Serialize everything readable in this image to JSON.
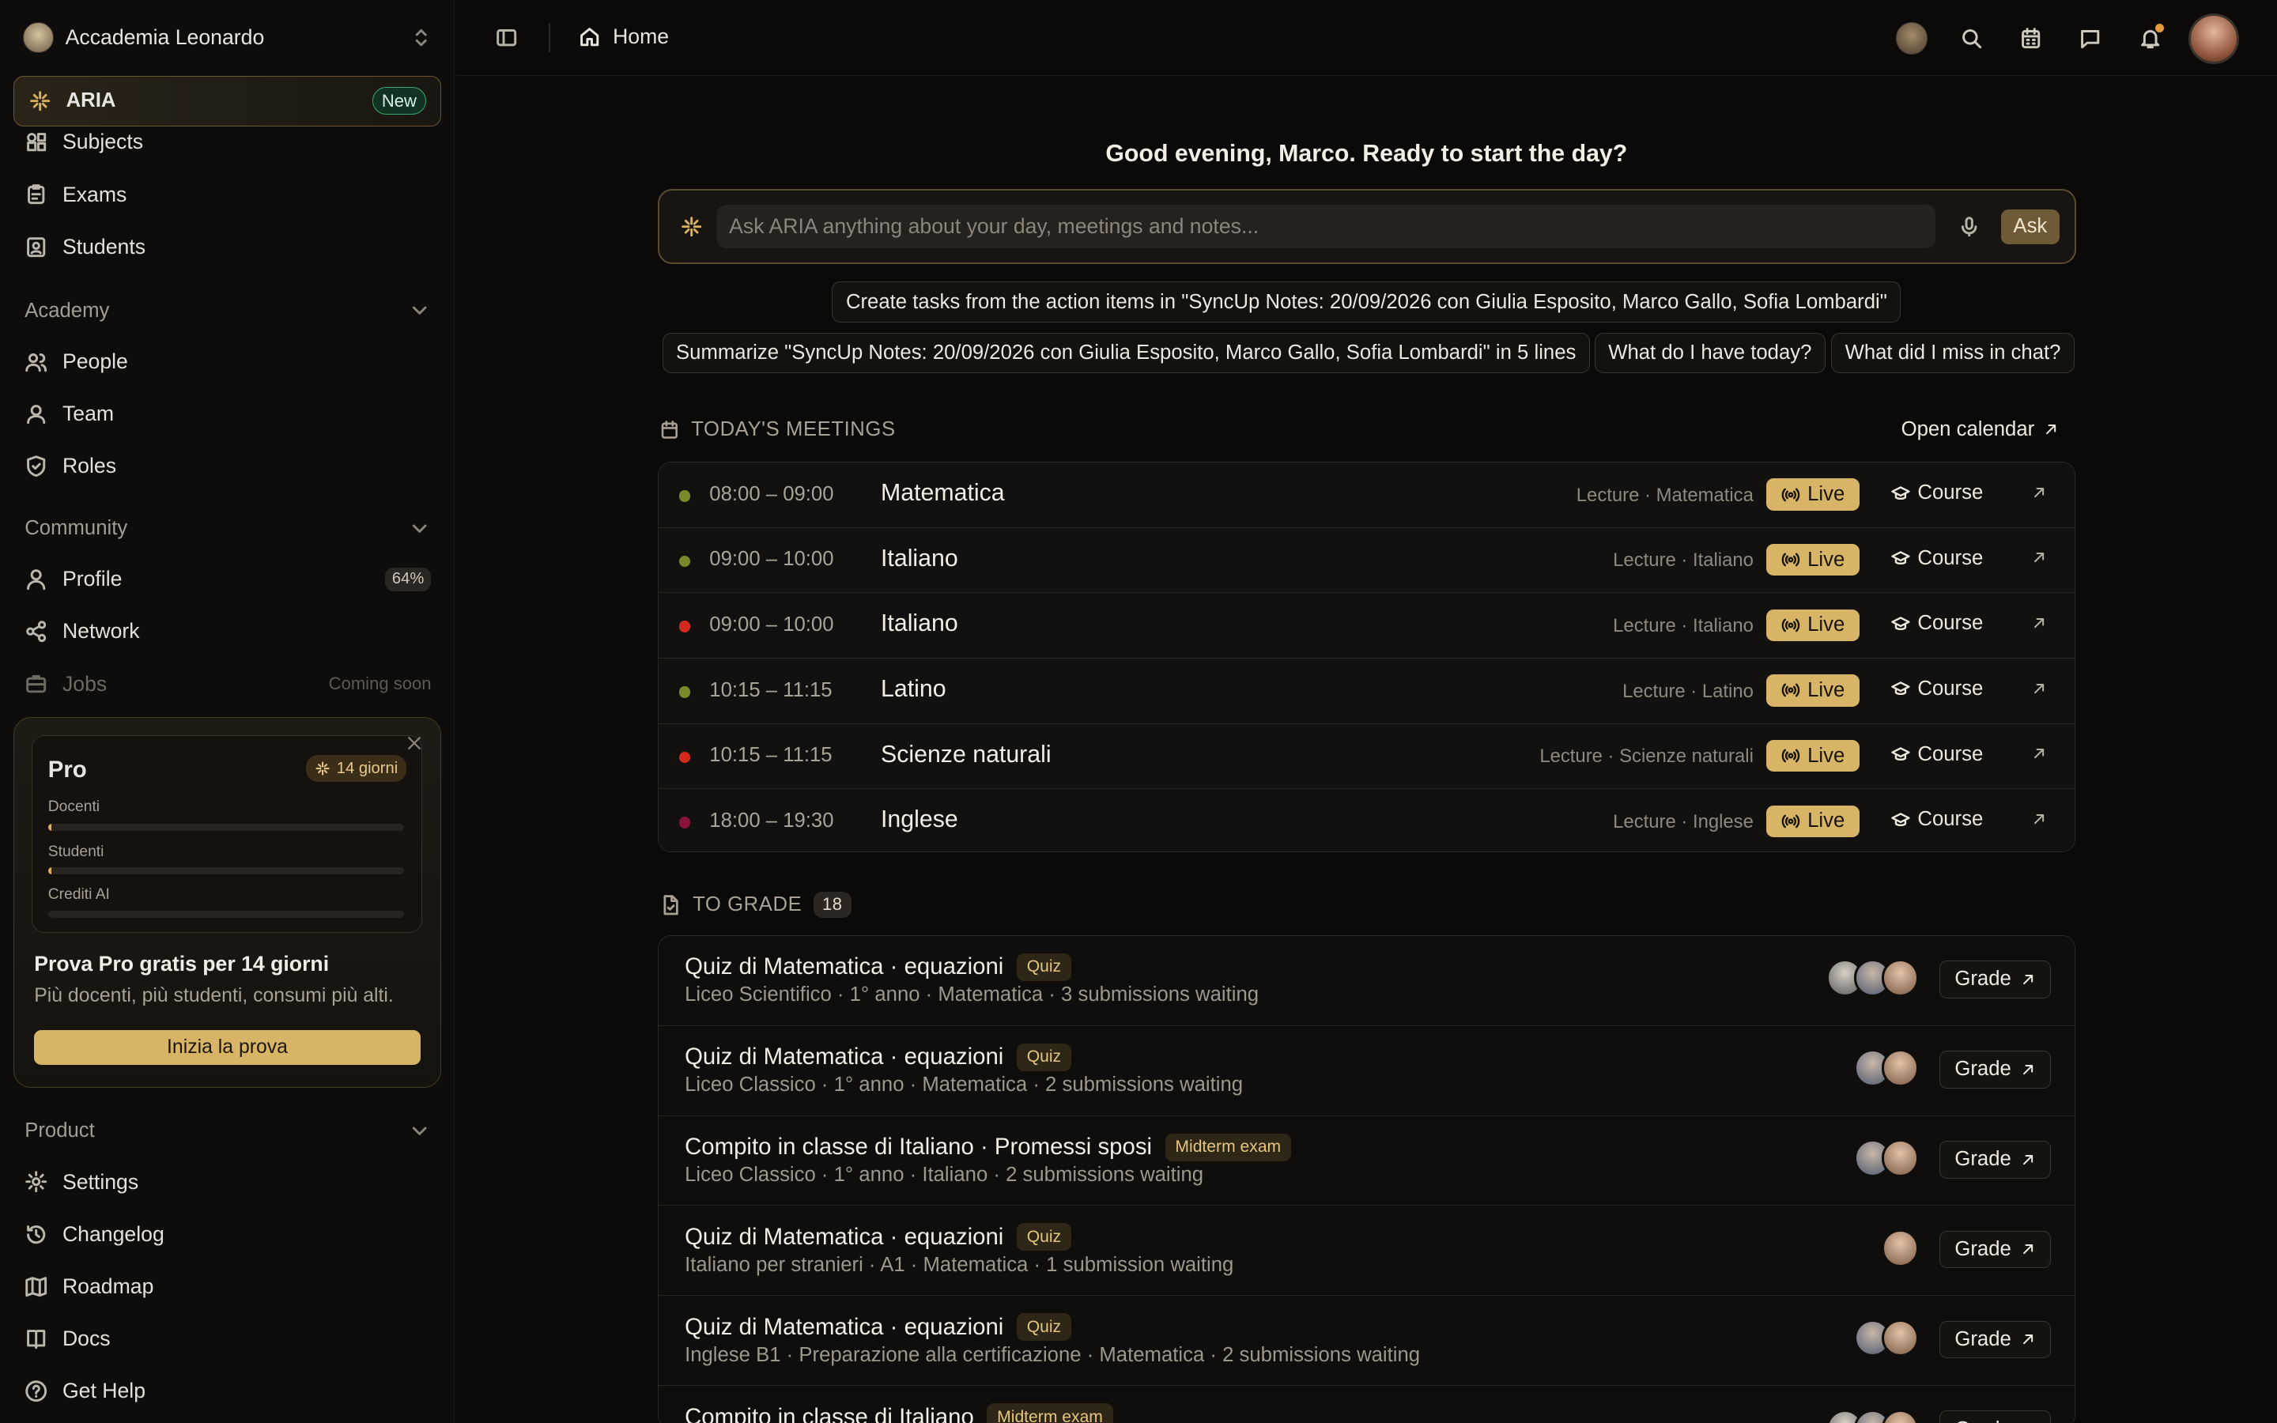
{
  "sidebar": {
    "org_name": "Accademia Leonardo",
    "aria": {
      "label": "ARIA",
      "badge": "New"
    },
    "top_items": [
      {
        "label": "Subjects",
        "icon": "shapes-icon"
      },
      {
        "label": "Exams",
        "icon": "clipboard-icon"
      },
      {
        "label": "Students",
        "icon": "id-badge-icon"
      }
    ],
    "academy": {
      "title": "Academy",
      "items": [
        {
          "label": "People",
          "icon": "users-icon"
        },
        {
          "label": "Team",
          "icon": "user-group-icon"
        },
        {
          "label": "Roles",
          "icon": "shield-icon"
        }
      ]
    },
    "community": {
      "title": "Community",
      "items": [
        {
          "label": "Profile",
          "icon": "user-icon",
          "pill": "64%"
        },
        {
          "label": "Network",
          "icon": "share-icon"
        },
        {
          "label": "Jobs",
          "icon": "briefcase-icon",
          "note": "Coming soon"
        }
      ]
    },
    "pro_card": {
      "title": "Pro",
      "badge": "14 giorni",
      "meters": [
        {
          "label": "Docenti",
          "fill": 0.01
        },
        {
          "label": "Studenti",
          "fill": 0.01
        },
        {
          "label": "Crediti AI",
          "fill": 0.0
        }
      ],
      "headline": "Prova Pro gratis per 14 giorni",
      "subtitle": "Più docenti, più studenti, consumi più alti.",
      "cta": "Inizia la prova"
    },
    "product": {
      "title": "Product",
      "items": [
        {
          "label": "Settings",
          "icon": "gear-icon"
        },
        {
          "label": "Changelog",
          "icon": "history-icon"
        },
        {
          "label": "Roadmap",
          "icon": "map-icon"
        },
        {
          "label": "Docs",
          "icon": "book-icon"
        },
        {
          "label": "Get Help",
          "icon": "help-circle-icon"
        }
      ]
    }
  },
  "topbar": {
    "breadcrumb": "Home"
  },
  "main": {
    "greeting": "Good evening, Marco. Ready to start the day?",
    "ask": {
      "placeholder": "Ask ARIA anything about your day, meetings and notes...",
      "button": "Ask"
    },
    "suggestions": [
      "Create tasks from the action items in \"SyncUp Notes: 20/09/2026 con Giulia Esposito, Marco Gallo, Sofia Lombardi\"",
      "Summarize \"SyncUp Notes: 20/09/2026 con Giulia Esposito, Marco Gallo, Sofia Lombardi\" in 5 lines",
      "What do I have today?",
      "What did I miss in chat?"
    ],
    "meetings": {
      "title": "TODAY'S MEETINGS",
      "open_calendar": "Open calendar",
      "live_label": "Live",
      "course_label": "Course",
      "rows": [
        {
          "time": "08:00 – 09:00",
          "title": "Matematica",
          "meta": "Lecture · Matematica",
          "dot": "#7a8a2a"
        },
        {
          "time": "09:00 – 10:00",
          "title": "Italiano",
          "meta": "Lecture · Italiano",
          "dot": "#7a8a2a"
        },
        {
          "time": "09:00 – 10:00",
          "title": "Italiano",
          "meta": "Lecture · Italiano",
          "dot": "#d42a1e"
        },
        {
          "time": "10:15 – 11:15",
          "title": "Latino",
          "meta": "Lecture · Latino",
          "dot": "#7a8a2a"
        },
        {
          "time": "10:15 – 11:15",
          "title": "Scienze naturali",
          "meta": "Lecture · Scienze naturali",
          "dot": "#d42a1e"
        },
        {
          "time": "18:00 – 19:30",
          "title": "Inglese",
          "meta": "Lecture · Inglese",
          "dot": "#8a1238"
        }
      ]
    },
    "to_grade": {
      "title": "TO GRADE",
      "count": "18",
      "button": "Grade",
      "rows": [
        {
          "title": "Quiz di Matematica · equazioni",
          "tag": "Quiz",
          "sub": "Liceo Scientifico · 1° anno · Matematica · 3 submissions waiting",
          "avatars": 3
        },
        {
          "title": "Quiz di Matematica · equazioni",
          "tag": "Quiz",
          "sub": "Liceo Classico · 1° anno · Matematica · 2 submissions waiting",
          "avatars": 2
        },
        {
          "title": "Compito in classe di Italiano · Promessi sposi",
          "tag": "Midterm exam",
          "sub": "Liceo Classico · 1° anno · Italiano · 2 submissions waiting",
          "avatars": 2
        },
        {
          "title": "Quiz di Matematica · equazioni",
          "tag": "Quiz",
          "sub": "Italiano per stranieri · A1 · Matematica · 1 submission waiting",
          "avatars": 1
        },
        {
          "title": "Quiz di Matematica · equazioni",
          "tag": "Quiz",
          "sub": "Inglese B1 · Preparazione alla certificazione · Matematica · 2 submissions waiting",
          "avatars": 2
        },
        {
          "title": "Compito in classe di Italiano",
          "tag": "Midterm exam",
          "sub": "",
          "avatars": 3
        }
      ]
    }
  },
  "colors": {
    "accent": "#d8b466",
    "background": "#0b0a09",
    "new_badge": "#3fa56b"
  }
}
